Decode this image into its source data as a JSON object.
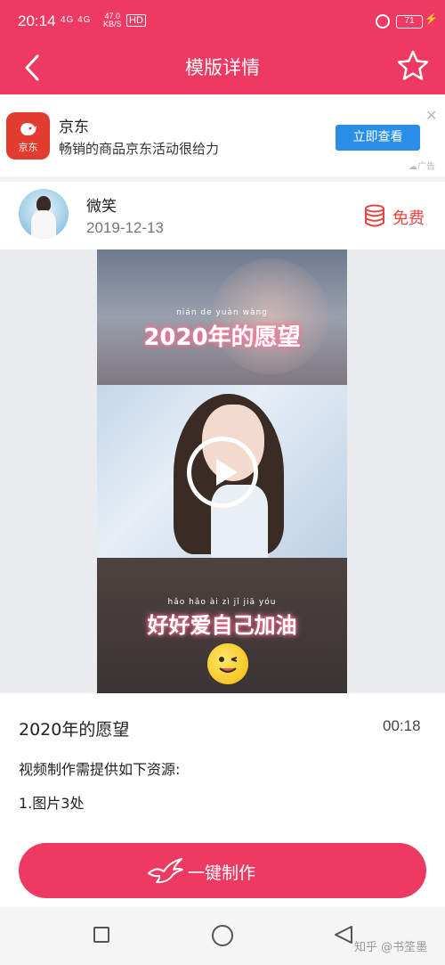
{
  "status_bar": {
    "time": "20:14",
    "network": "4G 4G",
    "speed_value": "47.0",
    "speed_unit": "KB/S",
    "hd": "HD",
    "battery": "71"
  },
  "nav": {
    "title": "模版详情",
    "back_icon": "back-chevron-icon",
    "favorite_icon": "star-outline-icon"
  },
  "ad": {
    "logo_text": "京东",
    "name": "京东",
    "description": "畅销的商品京东活动很给力",
    "button_label": "立即查看",
    "close_glyph": "✕",
    "tag": "广告"
  },
  "author": {
    "name": "微笑",
    "date": "2019-12-13",
    "price_label": "免费",
    "price_icon": "coin-stack-icon"
  },
  "video": {
    "top_pinyin": "nián  de  yuàn wàng",
    "top_text": "2020年的愿望",
    "bottom_pinyin": "hǎo  hǎo  ài   zì   jǐ   jiā  yóu",
    "bottom_text": "好好爱自己加油",
    "play_icon": "play-circle-icon"
  },
  "template": {
    "title": "2020年的愿望",
    "duration": "00:18",
    "resource_header": "视频制作需提供如下资源:",
    "resource_items": [
      "1.图片3处"
    ]
  },
  "action": {
    "make_label": "一键制作",
    "icon": "bird-icon"
  },
  "watermark": "知乎 @书筌墨",
  "colors": {
    "brand": "#ee3a63",
    "ad_button": "#2a8ee6",
    "price": "#e7463e",
    "jd_red": "#e23b30"
  }
}
